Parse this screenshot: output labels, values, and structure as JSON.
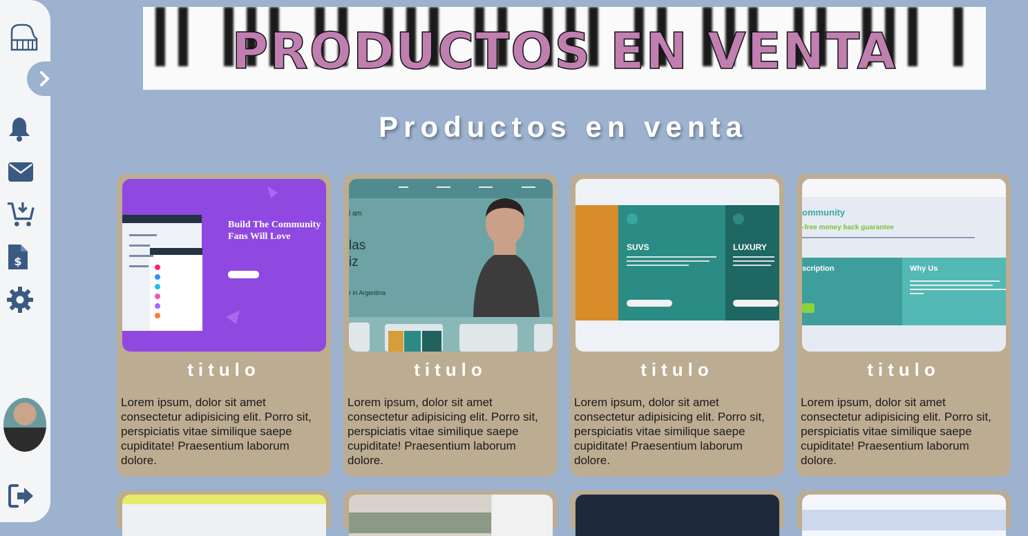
{
  "banner": {
    "title": "PRODUCTOS EN VENTA"
  },
  "page": {
    "subtitle": "Productos en venta"
  },
  "sidebar": {
    "icons": [
      "piano-icon",
      "chevron-right-icon",
      "bell-icon",
      "mail-icon",
      "cart-download-icon",
      "invoice-icon",
      "gear-icon",
      "logout-icon"
    ]
  },
  "products": [
    {
      "title": "titulo",
      "description": "Lorem ipsum, dolor sit amet consectetur adipisicing elit. Porro sit, perspiciatis vitae similique saepe cupiditate! Praesentium laborum dolore.",
      "thumb_text": [
        "Build The Community",
        "Fans Will Love"
      ]
    },
    {
      "title": "titulo",
      "description": "Lorem ipsum, dolor sit amet consectetur adipisicing elit. Porro sit, perspiciatis vitae similique saepe cupiditate! Praesentium laborum dolore.",
      "thumb_text": [
        "las",
        "iz",
        "r in Argentina"
      ]
    },
    {
      "title": "titulo",
      "description": "Lorem ipsum, dolor sit amet consectetur adipisicing elit. Porro sit, perspiciatis vitae similique saepe cupiditate! Praesentium laborum dolore.",
      "thumb_text": [
        "SUVS",
        "LUXURY"
      ]
    },
    {
      "title": "titulo",
      "description": "Lorem ipsum, dolor sit amet consectetur adipisicing elit. Porro sit, perspiciatis vitae similique saepe cupiditate! Praesentium laborum dolore.",
      "thumb_text": [
        "ommunity",
        "-free money back guarantee",
        "scription",
        "Why Us"
      ]
    }
  ],
  "colors": {
    "background": "#9cb2cf",
    "card": "#bcac92",
    "banner_title": "#c07fb0",
    "icon": "#3a5a82"
  }
}
